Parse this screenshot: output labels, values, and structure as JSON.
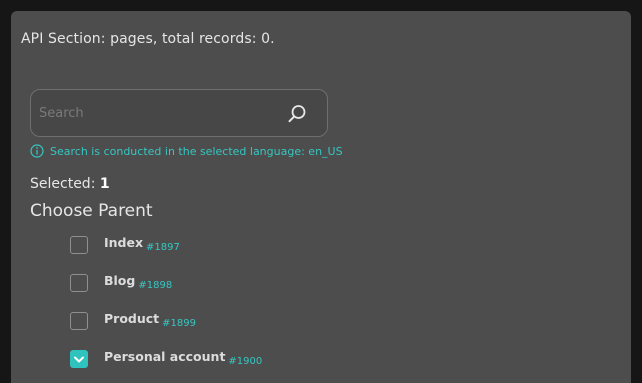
{
  "header": {
    "api_section_text": "API Section: pages, total records: 0."
  },
  "search": {
    "placeholder": "Search",
    "value": "",
    "hint": "Search is conducted in the selected language: en_US"
  },
  "selection": {
    "label": "Selected:",
    "count": "1"
  },
  "parent": {
    "title": "Choose Parent",
    "items": [
      {
        "label": "Index",
        "id": "#1897",
        "checked": false
      },
      {
        "label": "Blog",
        "id": "#1898",
        "checked": false
      },
      {
        "label": "Product",
        "id": "#1899",
        "checked": false
      },
      {
        "label": "Personal account",
        "id": "#1900",
        "checked": true
      }
    ]
  },
  "colors": {
    "modal_bg": "#4d4d4d",
    "accent": "#35c7c2",
    "text": "#e6e6e6"
  },
  "icons": {
    "search": "search-icon",
    "info": "info-icon",
    "check": "check-icon"
  }
}
